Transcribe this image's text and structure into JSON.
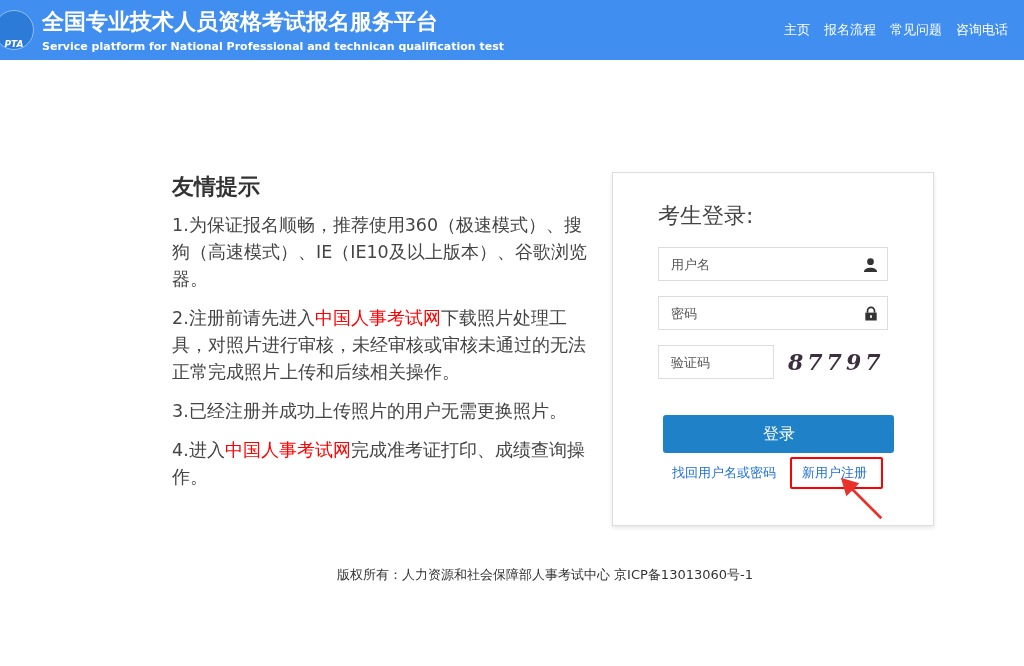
{
  "header": {
    "logo_text": "PTA",
    "title": "全国专业技术人员资格考试报名服务平台",
    "subtitle": "Service platform for National Professional and technican qualification test",
    "nav": [
      {
        "label": "主页"
      },
      {
        "label": "报名流程"
      },
      {
        "label": "常见问题"
      },
      {
        "label": "咨询电话"
      }
    ]
  },
  "tips": {
    "title": "友情提示",
    "items": [
      [
        {
          "kind": "text",
          "text": "1.为保证报名顺畅，推荐使用360（极速模式）、搜狗（高速模式）、IE（IE10及以上版本）、谷歌浏览器。"
        }
      ],
      [
        {
          "kind": "text",
          "text": "2.注册前请先进入"
        },
        {
          "kind": "link",
          "text": "中国人事考试网"
        },
        {
          "kind": "text",
          "text": "下载照片处理工具，对照片进行审核，未经审核或审核未通过的无法正常完成照片上传和后续相关操作。"
        }
      ],
      [
        {
          "kind": "text",
          "text": "3.已经注册并成功上传照片的用户无需更换照片。"
        }
      ],
      [
        {
          "kind": "text",
          "text": "4.进入"
        },
        {
          "kind": "link",
          "text": "中国人事考试网"
        },
        {
          "kind": "text",
          "text": "完成准考证打印、成绩查询操作。"
        }
      ]
    ]
  },
  "login": {
    "title": "考生登录:",
    "username": {
      "placeholder": "用户名"
    },
    "password": {
      "placeholder": "密码"
    },
    "captcha": {
      "placeholder": "验证码",
      "code": "87797"
    },
    "submit": "登录",
    "links": [
      {
        "label": "找回用户名或密码",
        "highlighted": false
      },
      {
        "label": "新用户注册",
        "highlighted": true
      }
    ]
  },
  "footer": "版权所有：人力资源和社会保障部人事考试中心 京ICP备13013060号-1"
}
